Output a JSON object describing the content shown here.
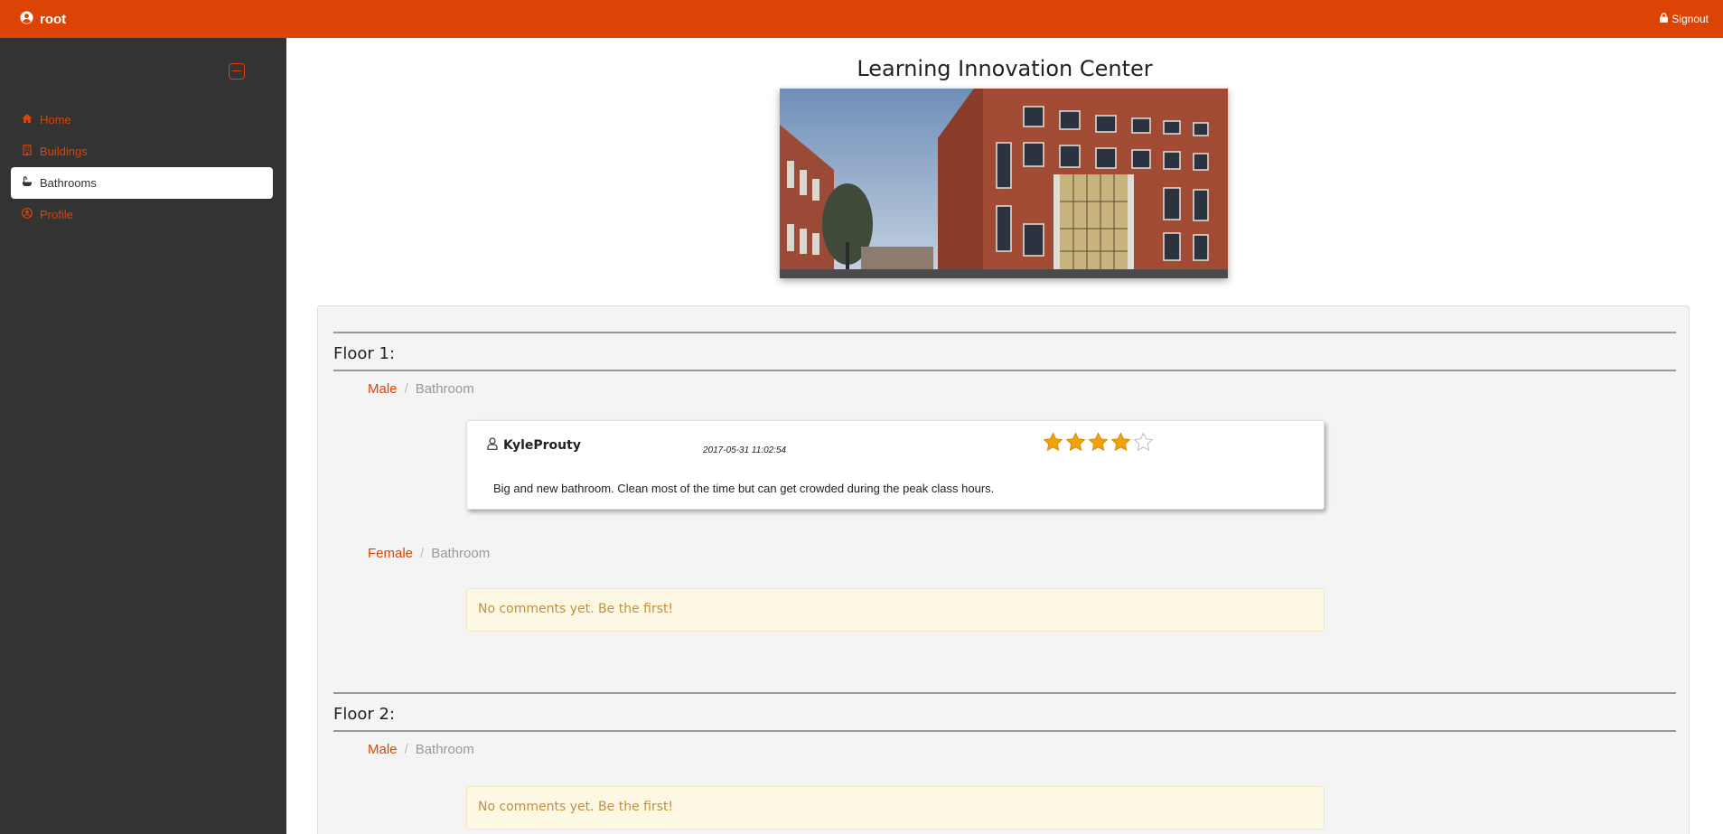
{
  "header": {
    "username": "root",
    "signout_label": "Signout"
  },
  "sidebar": {
    "items": [
      {
        "label": "Home",
        "icon": "home-icon"
      },
      {
        "label": "Buildings",
        "icon": "building-icon"
      },
      {
        "label": "Bathrooms",
        "icon": "bath-icon",
        "active": true
      },
      {
        "label": "Profile",
        "icon": "user-circle-icon"
      }
    ]
  },
  "main": {
    "title": "Learning Innovation Center",
    "floors": [
      {
        "title": "Floor 1:",
        "bathrooms": [
          {
            "gender": "Male",
            "type": "Bathroom",
            "reviews": [
              {
                "user": "KyleProuty",
                "date": "2017-05-31 11:02:54",
                "rating": 4,
                "max_rating": 5,
                "text": "Big and new bathroom. Clean most of the time but can get crowded during the peak class hours."
              }
            ]
          },
          {
            "gender": "Female",
            "type": "Bathroom",
            "empty_text": "No comments yet. Be the first!"
          }
        ]
      },
      {
        "title": "Floor 2:",
        "bathrooms": [
          {
            "gender": "Male",
            "type": "Bathroom",
            "empty_text": "No comments yet. Be the first!"
          }
        ]
      }
    ],
    "breadcrumb_separator": "/"
  },
  "colors": {
    "accent": "#dc4405",
    "sidebar_bg": "#333333",
    "star": "#f0a30a"
  }
}
